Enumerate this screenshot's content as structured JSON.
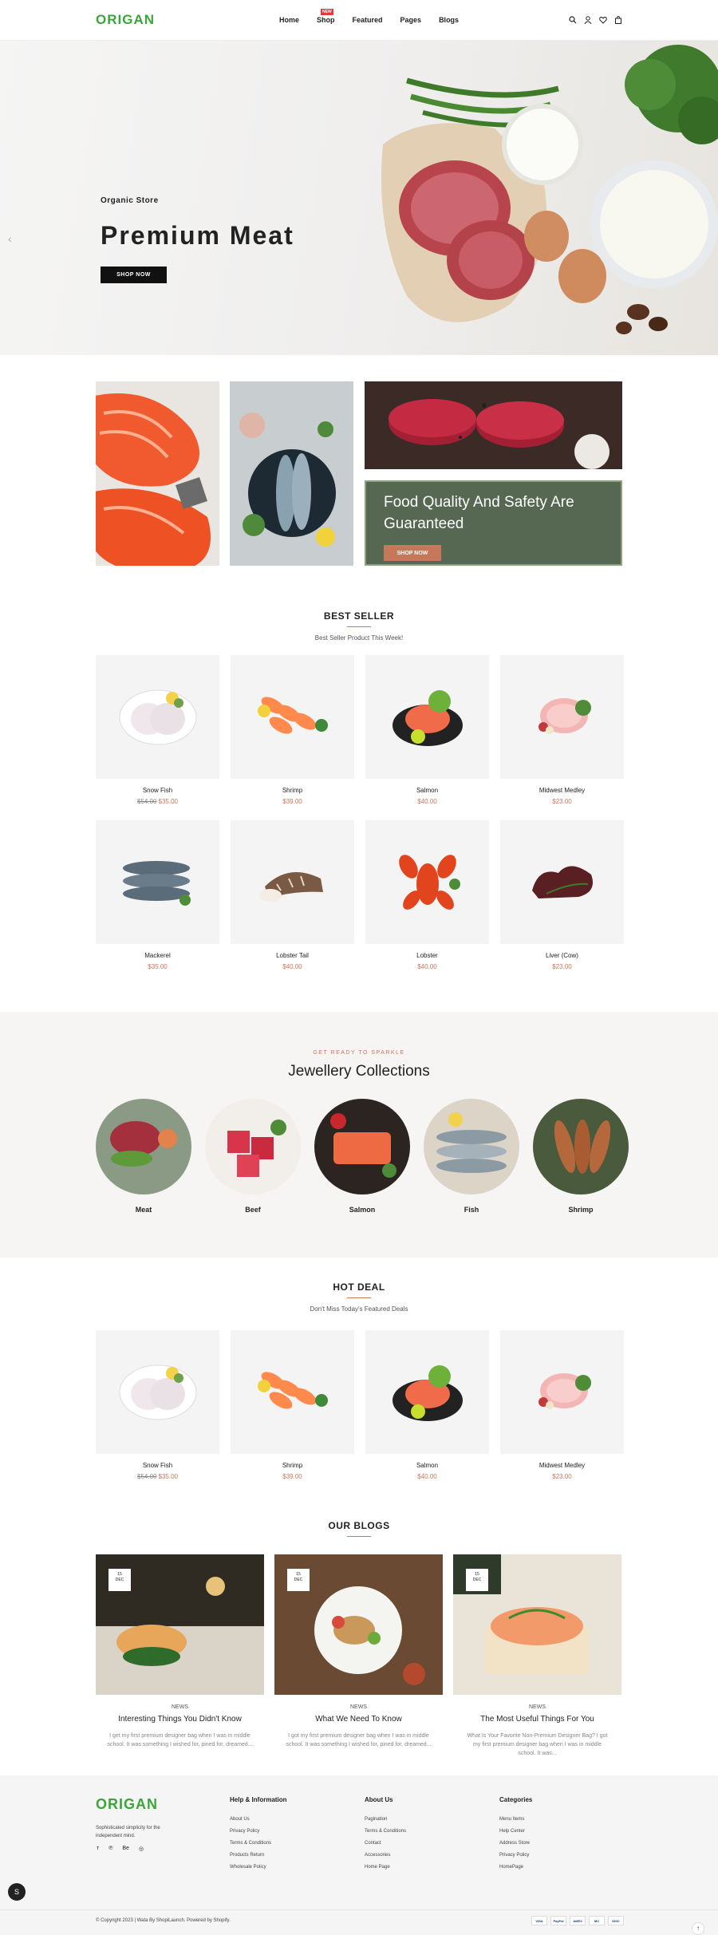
{
  "header": {
    "logo": "ORIGAN",
    "nav": [
      "Home",
      "Shop",
      "Featured",
      "Pages",
      "Blogs"
    ],
    "shop_badge": "NEW"
  },
  "hero": {
    "subtitle": "Organic Store",
    "title": "Premium Meat",
    "button": "SHOP NOW"
  },
  "promo": {
    "title": "Food Quality And Safety Are Guaranteed",
    "button": "SHOP NOW"
  },
  "best_seller": {
    "title": "BEST SELLER",
    "subtitle": "Best Seller Product This Week!",
    "products": [
      {
        "name": "Snow Fish",
        "old_price": "$54.00",
        "price": "$35.00"
      },
      {
        "name": "Shrimp",
        "old_price": "",
        "price": "$39.00"
      },
      {
        "name": "Salmon",
        "old_price": "",
        "price": "$40.00"
      },
      {
        "name": "Midwest Medley",
        "old_price": "",
        "price": "$23.00"
      },
      {
        "name": "Mackerel",
        "old_price": "",
        "price": "$35.00"
      },
      {
        "name": "Lobster Tail",
        "old_price": "",
        "price": "$40.00"
      },
      {
        "name": "Lobster",
        "old_price": "",
        "price": "$40.00"
      },
      {
        "name": "Liver (Cow)",
        "old_price": "",
        "price": "$23.00"
      }
    ]
  },
  "collections": {
    "kicker": "GET READY TO SPARKLE",
    "title": "Jewellery Collections",
    "items": [
      "Meat",
      "Beef",
      "Salmon",
      "Fish",
      "Shrimp"
    ]
  },
  "hot_deal": {
    "title": "HOT DEAL",
    "subtitle": "Don't Miss Today's Featured Deals",
    "products": [
      {
        "name": "Snow Fish",
        "old_price": "$54.00",
        "price": "$35.00"
      },
      {
        "name": "Shrimp",
        "old_price": "",
        "price": "$39.00"
      },
      {
        "name": "Salmon",
        "old_price": "",
        "price": "$40.00"
      },
      {
        "name": "Midwest Medley",
        "old_price": "",
        "price": "$23.00"
      }
    ]
  },
  "blogs": {
    "title": "OUR BLOGS",
    "posts": [
      {
        "day": "15",
        "month": "DEC",
        "tag": "NEWS",
        "title": "Interesting Things You Didn't Know",
        "excerpt": "I get my first premium designer bag when I was in middle school. It was something I wished for, pined for, dreamed..."
      },
      {
        "day": "15",
        "month": "DEC",
        "tag": "NEWS",
        "title": "What We Need To Know",
        "excerpt": "I got my first premium designer bag when I was in middle school. It was something I wished for, pined for, dreamed..."
      },
      {
        "day": "15",
        "month": "DEC",
        "tag": "NEWS",
        "title": "The Most Useful Things For You",
        "excerpt": "What Is Your Favorite Non-Premium Designer Bag? I got my first premium designer bag when I was in middle school. It was..."
      }
    ]
  },
  "footer": {
    "logo": "ORIGAN",
    "tagline": "Sophisticated simplicity for the independent mind.",
    "social": [
      "ᴛ",
      "℗",
      "Be",
      "◎"
    ],
    "columns": [
      {
        "title": "Help & Information",
        "links": [
          "About Us",
          "Privacy Policy",
          "Terms & Conditions",
          "Products Return",
          "Wholesale Policy"
        ]
      },
      {
        "title": "About Us",
        "links": [
          "Pagination",
          "Terms & Conditions",
          "Contact",
          "Accessories",
          "Home Page"
        ]
      },
      {
        "title": "Categories",
        "links": [
          "Menu Items",
          "Help Center",
          "Address Store",
          "Privacy Policy",
          "HomePage"
        ]
      }
    ],
    "copyright": "© Copyright 2023 | Wata By ShopiLaunch. Powered by Shopify.",
    "payments": [
      "VISA",
      "PayPal",
      "AMEX",
      "MC",
      "DISC"
    ]
  },
  "colors": {
    "brand": "#3aa53a",
    "accent": "#c9775b",
    "promo_bg": "#566852"
  }
}
